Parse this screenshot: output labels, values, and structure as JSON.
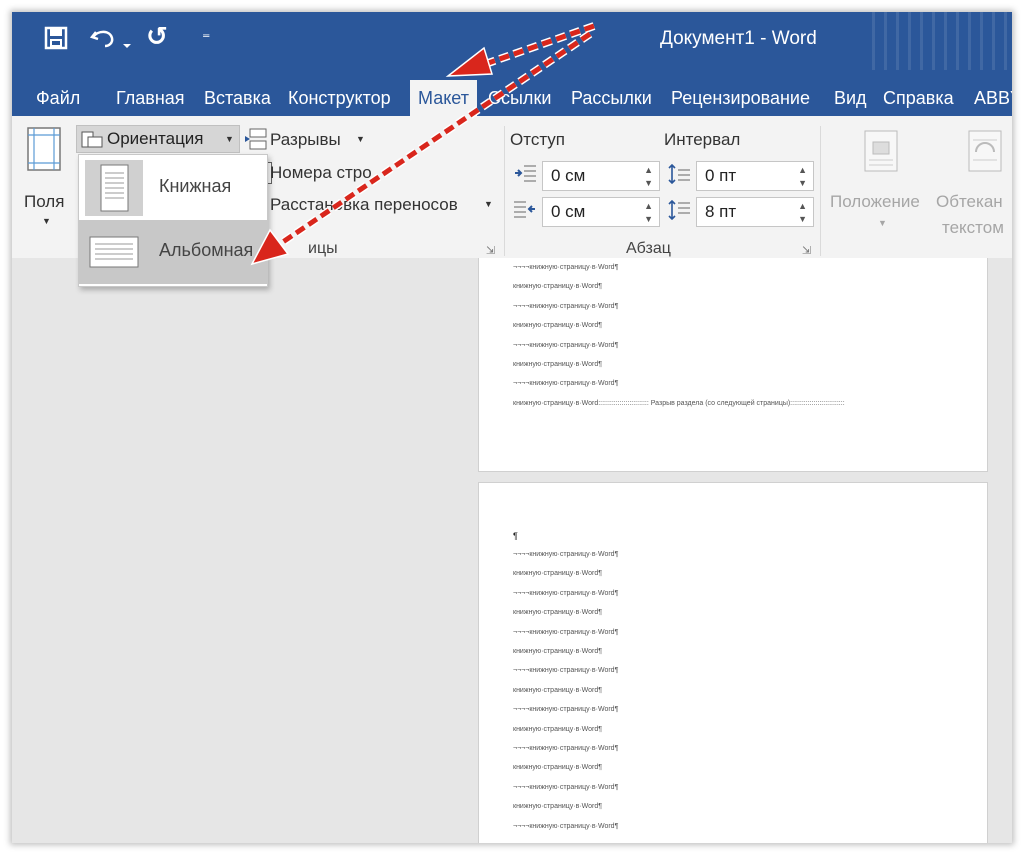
{
  "window": {
    "title": "Документ1  -  Word"
  },
  "qat": {
    "redo_symbol": "↺",
    "customize_symbol": "⁼"
  },
  "tabs": [
    {
      "label": "Файл"
    },
    {
      "label": "Главная"
    },
    {
      "label": "Вставка"
    },
    {
      "label": "Конструктор"
    },
    {
      "label": "Макет"
    },
    {
      "label": "Ссылки"
    },
    {
      "label": "Рассылки"
    },
    {
      "label": "Рецензирование"
    },
    {
      "label": "Вид"
    },
    {
      "label": "Справка"
    },
    {
      "label": "ABBY"
    }
  ],
  "ribbon": {
    "fields_label": "Поля",
    "orientation_label": "Ориентация",
    "breaks_label": "Разрывы",
    "line_numbers_label": "Номера стро",
    "hyphenation_label": "Расстановка переносов",
    "page_setup_partial": "ицы",
    "indent_title": "Отступ",
    "spacing_title": "Интервал",
    "indent_left": "0 см",
    "indent_right": "0 см",
    "spacing_before": "0 пт",
    "spacing_after": "8 пт",
    "paragraph_group": "Абзац",
    "position_label": "Положение",
    "wrap_label_line1": "Обтекан",
    "wrap_label_line2": "текстом"
  },
  "orientation_menu": [
    {
      "label": "Книжная"
    },
    {
      "label": "Альбомная"
    }
  ],
  "document": {
    "page1_lines": [
      "¬¬¬¬книжную·страницу·в·Word¶",
      "книжную·страницу·в·Word¶",
      "¬¬¬¬книжную·страницу·в·Word¶",
      "книжную·страницу·в·Word¶",
      "¬¬¬¬книжную·страницу·в·Word¶",
      "книжную·страницу·в·Word¶",
      "¬¬¬¬книжную·страницу·в·Word¶",
      "книжную·страницу·в·Word:::::::::::::::::::::::::: Разрыв раздела (со следующей страницы)::::::::::::::::::::::::::::"
    ],
    "page2_cursor": "¶",
    "page2_lines": [
      "¬¬¬¬книжную·страницу·в·Word¶",
      "книжную·страницу·в·Word¶",
      "¬¬¬¬книжную·страницу·в·Word¶",
      "книжную·страницу·в·Word¶",
      "¬¬¬¬книжную·страницу·в·Word¶",
      "книжную·страницу·в·Word¶",
      "¬¬¬¬книжную·страницу·в·Word¶",
      "книжную·страницу·в·Word¶",
      "¬¬¬¬книжную·страницу·в·Word¶",
      "книжную·страницу·в·Word¶",
      "¬¬¬¬книжную·страницу·в·Word¶",
      "книжную·страницу·в·Word¶",
      "¬¬¬¬книжную·страницу·в·Word¶",
      "книжную·страницу·в·Word¶",
      "¬¬¬¬книжную·страницу·в·Word¶"
    ]
  },
  "colors": {
    "word_blue": "#2b579a",
    "arrow_red": "#d9261c"
  }
}
